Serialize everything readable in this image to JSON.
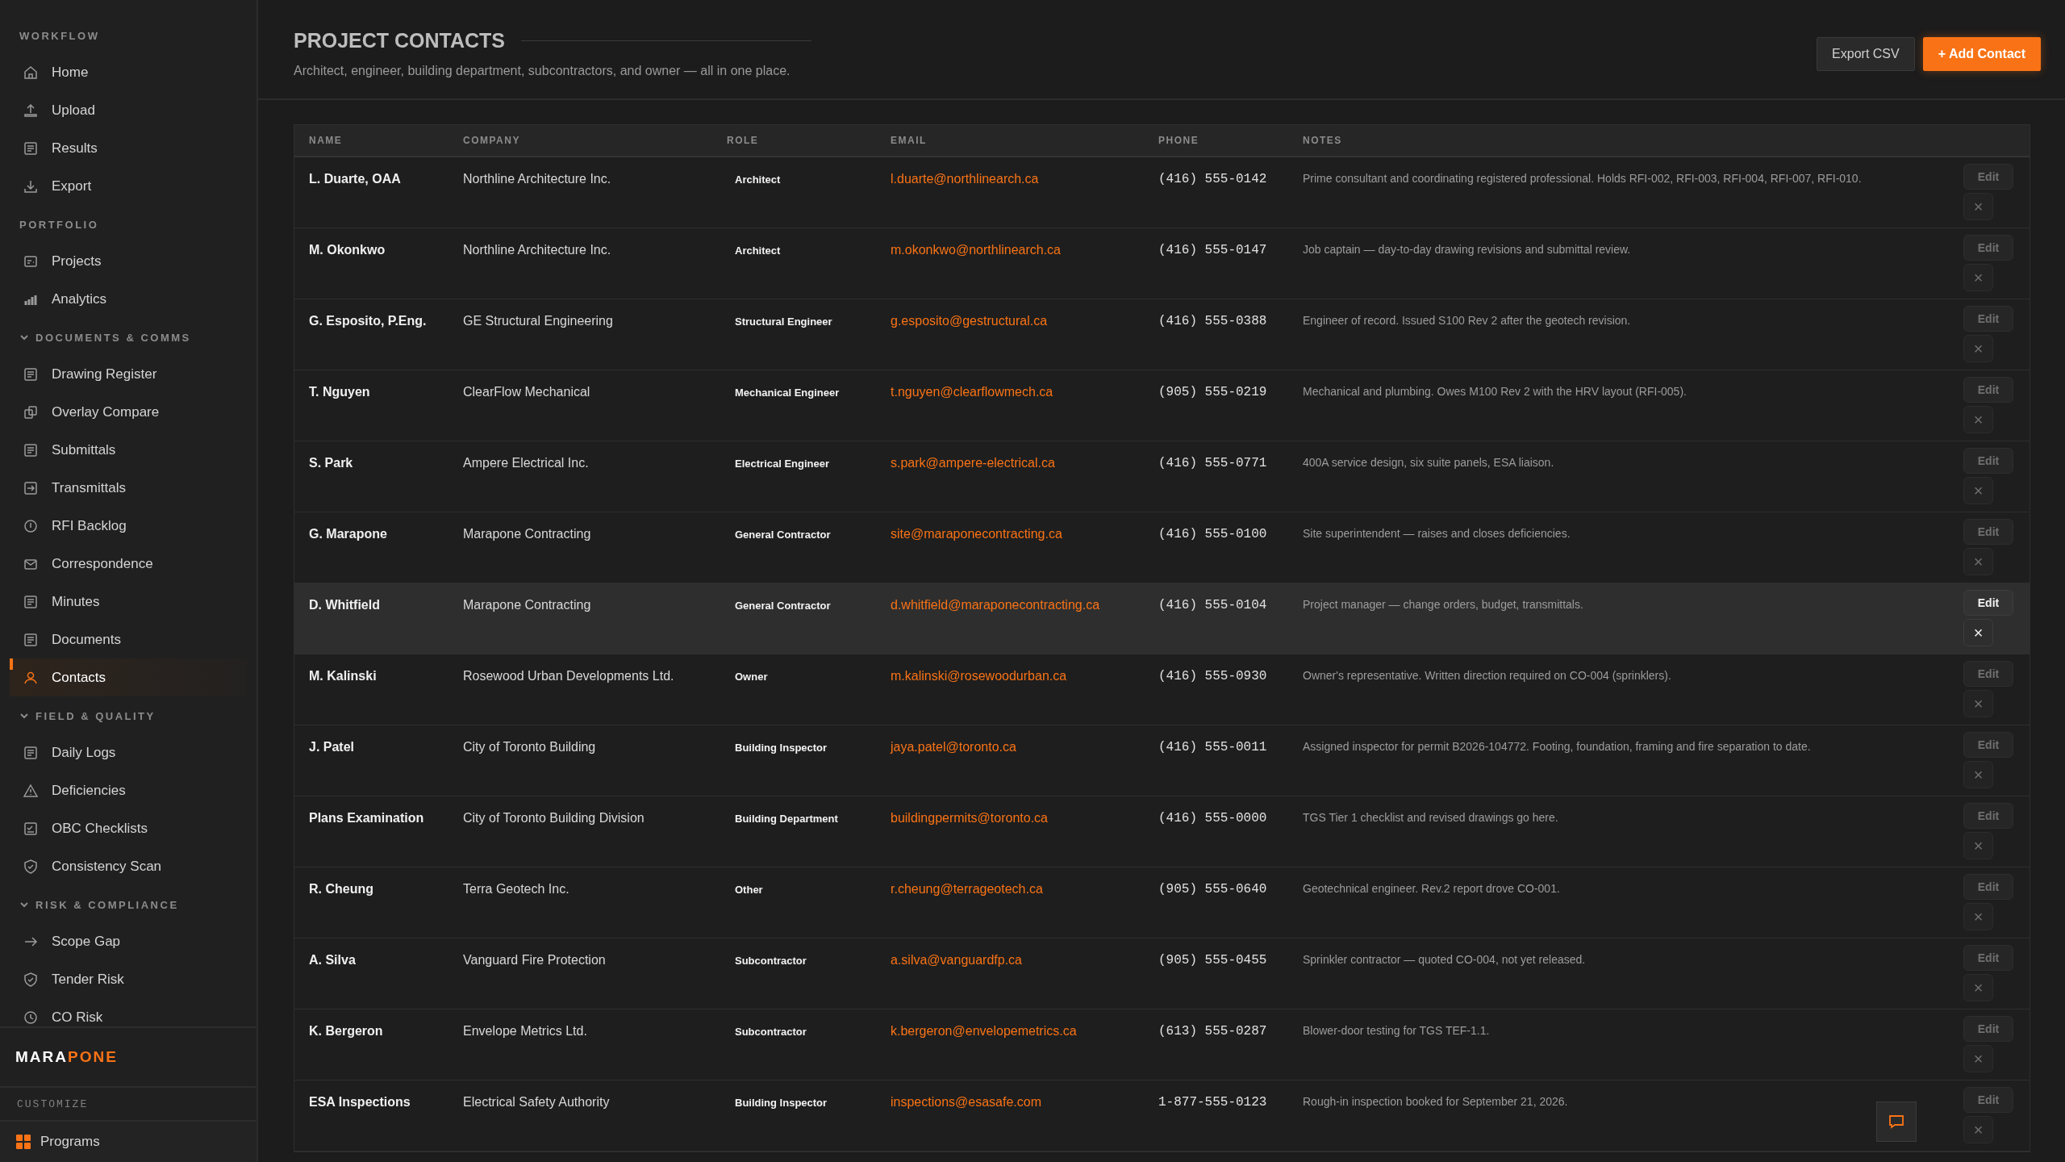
{
  "sidebar": {
    "sections": [
      {
        "kind": "plain",
        "title": "WORKFLOW",
        "items": [
          {
            "label": "Home",
            "selected": false
          },
          {
            "label": "Upload",
            "selected": false
          },
          {
            "label": "Results",
            "selected": false
          },
          {
            "label": "Export",
            "selected": false
          }
        ]
      },
      {
        "kind": "plain",
        "title": "PORTFOLIO",
        "items": [
          {
            "label": "Projects",
            "selected": false
          },
          {
            "label": "Analytics",
            "selected": false
          }
        ]
      },
      {
        "kind": "group",
        "title": "DOCUMENTS & COMMS",
        "expanded": true,
        "items": [
          {
            "label": "Drawing Register",
            "selected": false
          },
          {
            "label": "Overlay Compare",
            "selected": false
          },
          {
            "label": "Submittals",
            "selected": false
          },
          {
            "label": "Transmittals",
            "selected": false
          },
          {
            "label": "RFI Backlog",
            "selected": false
          },
          {
            "label": "Correspondence",
            "selected": false
          },
          {
            "label": "Minutes",
            "selected": false
          },
          {
            "label": "Documents",
            "selected": false
          },
          {
            "label": "Contacts",
            "selected": true
          }
        ]
      },
      {
        "kind": "group",
        "title": "FIELD & QUALITY",
        "expanded": true,
        "items": [
          {
            "label": "Daily Logs",
            "selected": false
          },
          {
            "label": "Deficiencies",
            "selected": false
          },
          {
            "label": "OBC Checklists",
            "selected": false
          },
          {
            "label": "Consistency Scan",
            "selected": false
          }
        ]
      },
      {
        "kind": "group",
        "title": "RISK & COMPLIANCE",
        "expanded": true,
        "items": [
          {
            "label": "Scope Gap",
            "selected": false
          },
          {
            "label": "Tender Risk",
            "selected": false
          },
          {
            "label": "CO Risk",
            "selected": false
          }
        ]
      }
    ],
    "brand": {
      "primary": "MARA",
      "accent": "PONE"
    },
    "customize_label": "CUSTOMIZE",
    "programs": "Programs"
  },
  "header": {
    "title": "PROJECT CONTACTS",
    "subtitle": "Architect, engineer, building department, subcontractors, and owner — all in one place.",
    "buttons": [
      {
        "label": "Export CSV",
        "kind": "secondary"
      },
      {
        "label": "+ Add Contact",
        "kind": "primary"
      }
    ]
  },
  "table": {
    "columns": [
      "NAME",
      "COMPANY",
      "ROLE",
      "EMAIL",
      "PHONE",
      "NOTES"
    ],
    "rows": [
      {
        "name": "L. Duarte, OAA",
        "company": "Northline Architecture Inc.",
        "role": "Architect",
        "email": "l.duarte@northlinearch.ca",
        "phone": "(416) 555-0142",
        "notes": "Prime consultant and coordinating registered professional. Holds RFI-002, RFI-003, RFI-004, RFI-007, RFI-010.",
        "edit": "Edit",
        "delete": "×",
        "selected": false
      },
      {
        "name": "M. Okonkwo",
        "company": "Northline Architecture Inc.",
        "role": "Architect",
        "email": "m.okonkwo@northlinearch.ca",
        "phone": "(416) 555-0147",
        "notes": "Job captain — day-to-day drawing revisions and submittal review.",
        "edit": "Edit",
        "delete": "×",
        "selected": false
      },
      {
        "name": "G. Esposito, P.Eng.",
        "company": "GE Structural Engineering",
        "role": "Structural Engineer",
        "email": "g.esposito@gestructural.ca",
        "phone": "(416) 555-0388",
        "notes": "Engineer of record. Issued S100 Rev 2 after the geotech revision.",
        "edit": "Edit",
        "delete": "×",
        "selected": false
      },
      {
        "name": "T. Nguyen",
        "company": "ClearFlow Mechanical",
        "role": "Mechanical Engineer",
        "email": "t.nguyen@clearflowmech.ca",
        "phone": "(905) 555-0219",
        "notes": "Mechanical and plumbing. Owes M100 Rev 2 with the HRV layout (RFI-005).",
        "edit": "Edit",
        "delete": "×",
        "selected": false
      },
      {
        "name": "S. Park",
        "company": "Ampere Electrical Inc.",
        "role": "Electrical Engineer",
        "email": "s.park@ampere-electrical.ca",
        "phone": "(416) 555-0771",
        "notes": "400A service design, six suite panels, ESA liaison.",
        "edit": "Edit",
        "delete": "×",
        "selected": false
      },
      {
        "name": "G. Marapone",
        "company": "Marapone Contracting",
        "role": "General Contractor",
        "email": "site@maraponecontracting.ca",
        "phone": "(416) 555-0100",
        "notes": "Site superintendent — raises and closes deficiencies.",
        "edit": "Edit",
        "delete": "×",
        "selected": false
      },
      {
        "name": "D. Whitfield",
        "company": "Marapone Contracting",
        "role": "General Contractor",
        "email": "d.whitfield@maraponecontracting.ca",
        "phone": "(416) 555-0104",
        "notes": "Project manager — change orders, budget, transmittals.",
        "edit": "Edit",
        "delete": "×",
        "selected": true
      },
      {
        "name": "M. Kalinski",
        "company": "Rosewood Urban Developments Ltd.",
        "role": "Owner",
        "email": "m.kalinski@rosewoodurban.ca",
        "phone": "(416) 555-0930",
        "notes": "Owner's representative. Written direction required on CO-004 (sprinklers).",
        "edit": "Edit",
        "delete": "×",
        "selected": false
      },
      {
        "name": "J. Patel",
        "company": "City of Toronto Building",
        "role": "Building Inspector",
        "email": "jaya.patel@toronto.ca",
        "phone": "(416) 555-0011",
        "notes": "Assigned inspector for permit B2026-104772. Footing, foundation, framing and fire separation to date.",
        "edit": "Edit",
        "delete": "×",
        "selected": false
      },
      {
        "name": "Plans Examination",
        "company": "City of Toronto Building Division",
        "role": "Building Department",
        "email": "buildingpermits@toronto.ca",
        "phone": "(416) 555-0000",
        "notes": "TGS Tier 1 checklist and revised drawings go here.",
        "edit": "Edit",
        "delete": "×",
        "selected": false
      },
      {
        "name": "R. Cheung",
        "company": "Terra Geotech Inc.",
        "role": "Other",
        "email": "r.cheung@terrageotech.ca",
        "phone": "(905) 555-0640",
        "notes": "Geotechnical engineer. Rev.2 report drove CO-001.",
        "edit": "Edit",
        "delete": "×",
        "selected": false
      },
      {
        "name": "A. Silva",
        "company": "Vanguard Fire Protection",
        "role": "Subcontractor",
        "email": "a.silva@vanguardfp.ca",
        "phone": "(905) 555-0455",
        "notes": "Sprinkler contractor — quoted CO-004, not yet released.",
        "edit": "Edit",
        "delete": "×",
        "selected": false
      },
      {
        "name": "K. Bergeron",
        "company": "Envelope Metrics Ltd.",
        "role": "Subcontractor",
        "email": "k.bergeron@envelopemetrics.ca",
        "phone": "(613) 555-0287",
        "notes": "Blower-door testing for TGS TEF-1.1.",
        "edit": "Edit",
        "delete": "×",
        "selected": false
      },
      {
        "name": "ESA Inspections",
        "company": "Electrical Safety Authority",
        "role": "Building Inspector",
        "email": "inspections@esasafe.com",
        "phone": "1-877-555-0123",
        "notes": "Rough-in inspection booked for September 21, 2026.",
        "edit": "Edit",
        "delete": "×",
        "selected": false
      }
    ]
  }
}
